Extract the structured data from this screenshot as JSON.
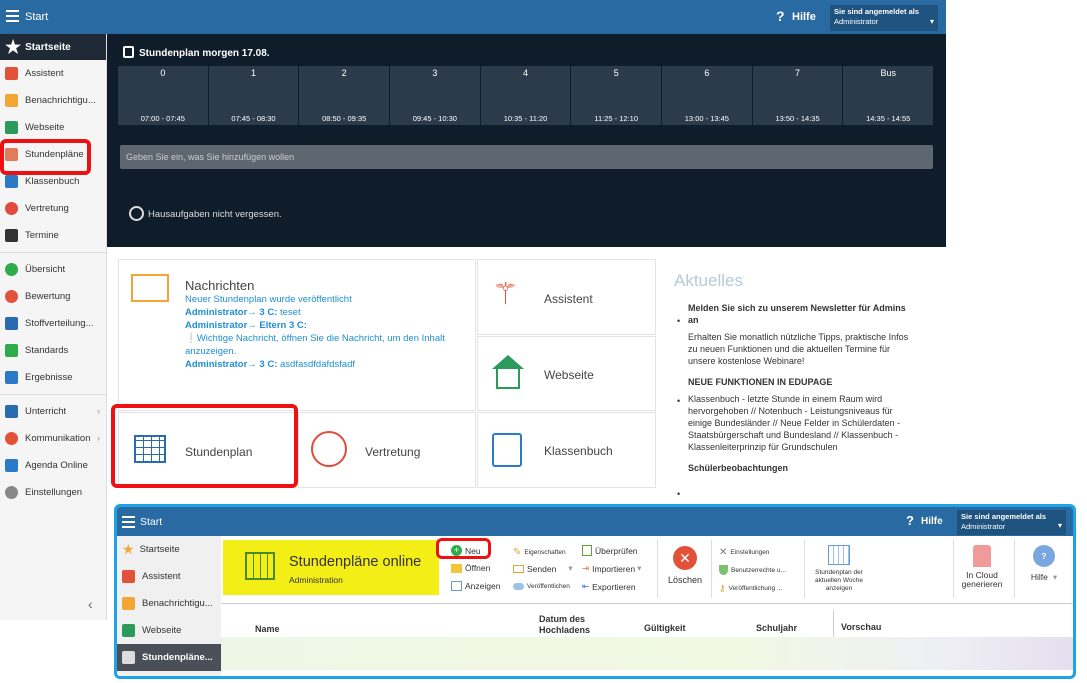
{
  "topbar": {
    "start": "Start",
    "help": "Hilfe",
    "logged_in_label": "Sie sind angemeldet als",
    "user": "Administrator"
  },
  "sidebar": {
    "home": "Startseite",
    "items": [
      "Assistent",
      "Benachrichtigu...",
      "Webseite",
      "Stundenpläne",
      "Klassenbuch",
      "Vertretung",
      "Termine",
      "Übersicht",
      "Bewertung",
      "Stoffverteilung...",
      "Standards",
      "Ergebnisse",
      "Unterricht",
      "Kommunikation",
      "Agenda Online",
      "Einstellungen"
    ]
  },
  "schedule": {
    "title": "Stundenplan morgen 17.08.",
    "periods": [
      {
        "num": "0",
        "time": "07:00 - 07:45"
      },
      {
        "num": "1",
        "time": "07:45 - 08:30"
      },
      {
        "num": "2",
        "time": "08:50 - 09:35"
      },
      {
        "num": "3",
        "time": "09:45 - 10:30"
      },
      {
        "num": "4",
        "time": "10:35 - 11:20"
      },
      {
        "num": "5",
        "time": "11:25 - 12:10"
      },
      {
        "num": "6",
        "time": "13:00 - 13:45"
      },
      {
        "num": "7",
        "time": "13:50 - 14:35"
      },
      {
        "num": "Bus",
        "time": "14:35 - 14:55"
      }
    ],
    "input_placeholder": "Geben Sie ein, was Sie hinzufügen wollen",
    "homework": "Hausaufgaben nicht vergessen."
  },
  "messages": {
    "title": "Nachrichten",
    "line1": "Neuer Stundenplan wurde veröffentlicht",
    "l2_from": "Administrator→ 3 C:",
    "l2_text": " teset",
    "l3_from": "Administrator→ Eltern 3 C:",
    "l4": "Wichtige Nachricht, öffnen Sie die Nachricht, um den Inhalt anzuzeigen.",
    "l5_from": "Administrator→ 3 C:",
    "l5_text": " asdfasdfdafdsfadf"
  },
  "tiles": {
    "assistent": "Assistent",
    "webseite": "Webseite",
    "stundenplan": "Stundenplan",
    "vertretung": "Vertretung",
    "klassenbuch": "Klassenbuch"
  },
  "news": {
    "title": "Aktuelles",
    "h1": "Melden Sie sich zu unserem Newsletter für Admins an",
    "p1": "Erhalten Sie monatlich nützliche Tipps, praktische Infos zu neuen Funktionen und die aktuellen Termine für unsere kostenlose Webinare!",
    "h2": "NEUE FUNKTIONEN IN EDUPAGE",
    "p2": "Klassenbuch - letzte Stunde in einem Raum wird hervorgehoben // Notenbuch - Leistungsniveaus für einige Bundesländer // Neue Felder in Schülerdaten - Staatsbürgerschaft und Bundesland // Klassenbuch - Klassenleiterprinzip für Grundschulen",
    "h3": "Schülerbeobachtungen"
  },
  "bottom": {
    "start": "Start",
    "help": "Hilfe",
    "logged_in_label": "Sie sind angemeldet als",
    "user": "Administrator",
    "sidebar": [
      "Startseite",
      "Assistent",
      "Benachrichtigu...",
      "Webseite",
      "Stundenpläne..."
    ],
    "module_title": "Stundenpläne online",
    "module_sub": "Administration",
    "ribbon": {
      "neu": "Neu",
      "offnen": "Öffnen",
      "anzeigen": "Anzeigen",
      "eigenschaften": "Eigenschaften",
      "senden": "Senden",
      "veroeffentlichen": "Veröffentlichen",
      "ueberpruefen": "Überprüfen",
      "importieren": "Importieren",
      "exportieren": "Exportieren",
      "loeschen": "Löschen",
      "einstellungen": "Einstellungen",
      "benutzerrechte": "Benutzerrechte u...",
      "veroeffentlichung": "Veröffentlichung ...",
      "stundenplan_woche": "Stundenplan der aktuellen Woche anzeigen",
      "cloud": "In Cloud generieren",
      "hilfe": "Hilfe"
    },
    "columns": [
      "Name",
      "Datum des Hochladens",
      "Gültigkeit",
      "Schuljahr",
      "Vorschau"
    ]
  }
}
